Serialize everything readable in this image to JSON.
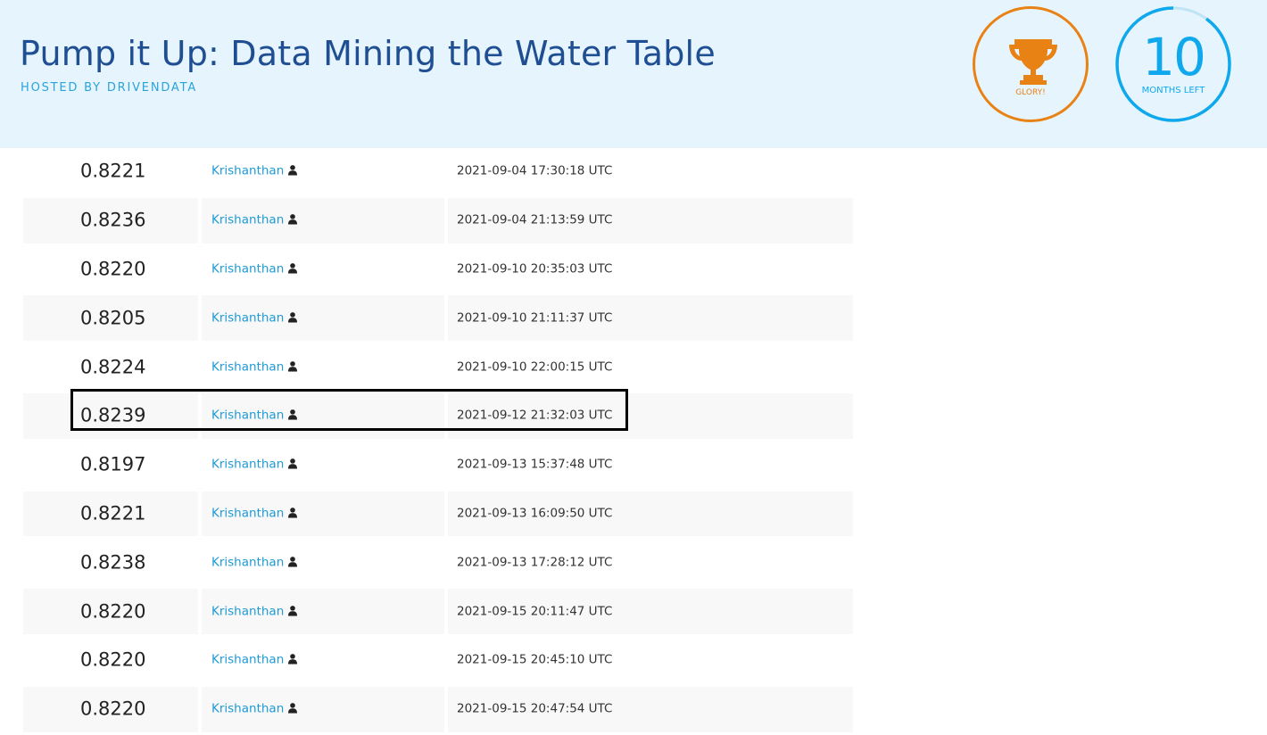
{
  "header": {
    "title": "Pump it Up: Data Mining the Water Table",
    "hosted_by": "HOSTED BY DRIVENDATA",
    "prize_label": "GLORY!",
    "time_number": "10",
    "time_unit": "MONTHS LEFT",
    "background": "#e6f5fd",
    "prize_color": "#e98214",
    "time_color": "#0fa8ec",
    "time_remaining_fraction": 0.9
  },
  "submissions": [
    {
      "score": "0.8221",
      "user": "Krishanthan",
      "user_icon": "user-icon",
      "timestamp": "2021-09-04 17:30:18 UTC"
    },
    {
      "score": "0.8236",
      "user": "Krishanthan",
      "user_icon": "user-icon",
      "timestamp": "2021-09-04 21:13:59 UTC"
    },
    {
      "score": "0.8220",
      "user": "Krishanthan",
      "user_icon": "user-icon",
      "timestamp": "2021-09-10 20:35:03 UTC"
    },
    {
      "score": "0.8205",
      "user": "Krishanthan",
      "user_icon": "user-icon",
      "timestamp": "2021-09-10 21:11:37 UTC"
    },
    {
      "score": "0.8224",
      "user": "Krishanthan",
      "user_icon": "user-icon",
      "timestamp": "2021-09-10 22:00:15 UTC"
    },
    {
      "score": "0.8239",
      "user": "Krishanthan",
      "user_icon": "user-icon",
      "timestamp": "2021-09-12 21:32:03 UTC"
    },
    {
      "score": "0.8197",
      "user": "Krishanthan",
      "user_icon": "user-icon",
      "timestamp": "2021-09-13 15:37:48 UTC"
    },
    {
      "score": "0.8221",
      "user": "Krishanthan",
      "user_icon": "user-icon",
      "timestamp": "2021-09-13 16:09:50 UTC"
    },
    {
      "score": "0.8238",
      "user": "Krishanthan",
      "user_icon": "user-icon",
      "timestamp": "2021-09-13 17:28:12 UTC"
    },
    {
      "score": "0.8220",
      "user": "Krishanthan",
      "user_icon": "user-icon",
      "timestamp": "2021-09-15 20:11:47 UTC"
    },
    {
      "score": "0.8220",
      "user": "Krishanthan",
      "user_icon": "user-icon",
      "timestamp": "2021-09-15 20:45:10 UTC"
    },
    {
      "score": "0.8220",
      "user": "Krishanthan",
      "user_icon": "user-icon",
      "timestamp": "2021-09-15 20:47:54 UTC"
    }
  ],
  "highlighted_row_index": 5
}
